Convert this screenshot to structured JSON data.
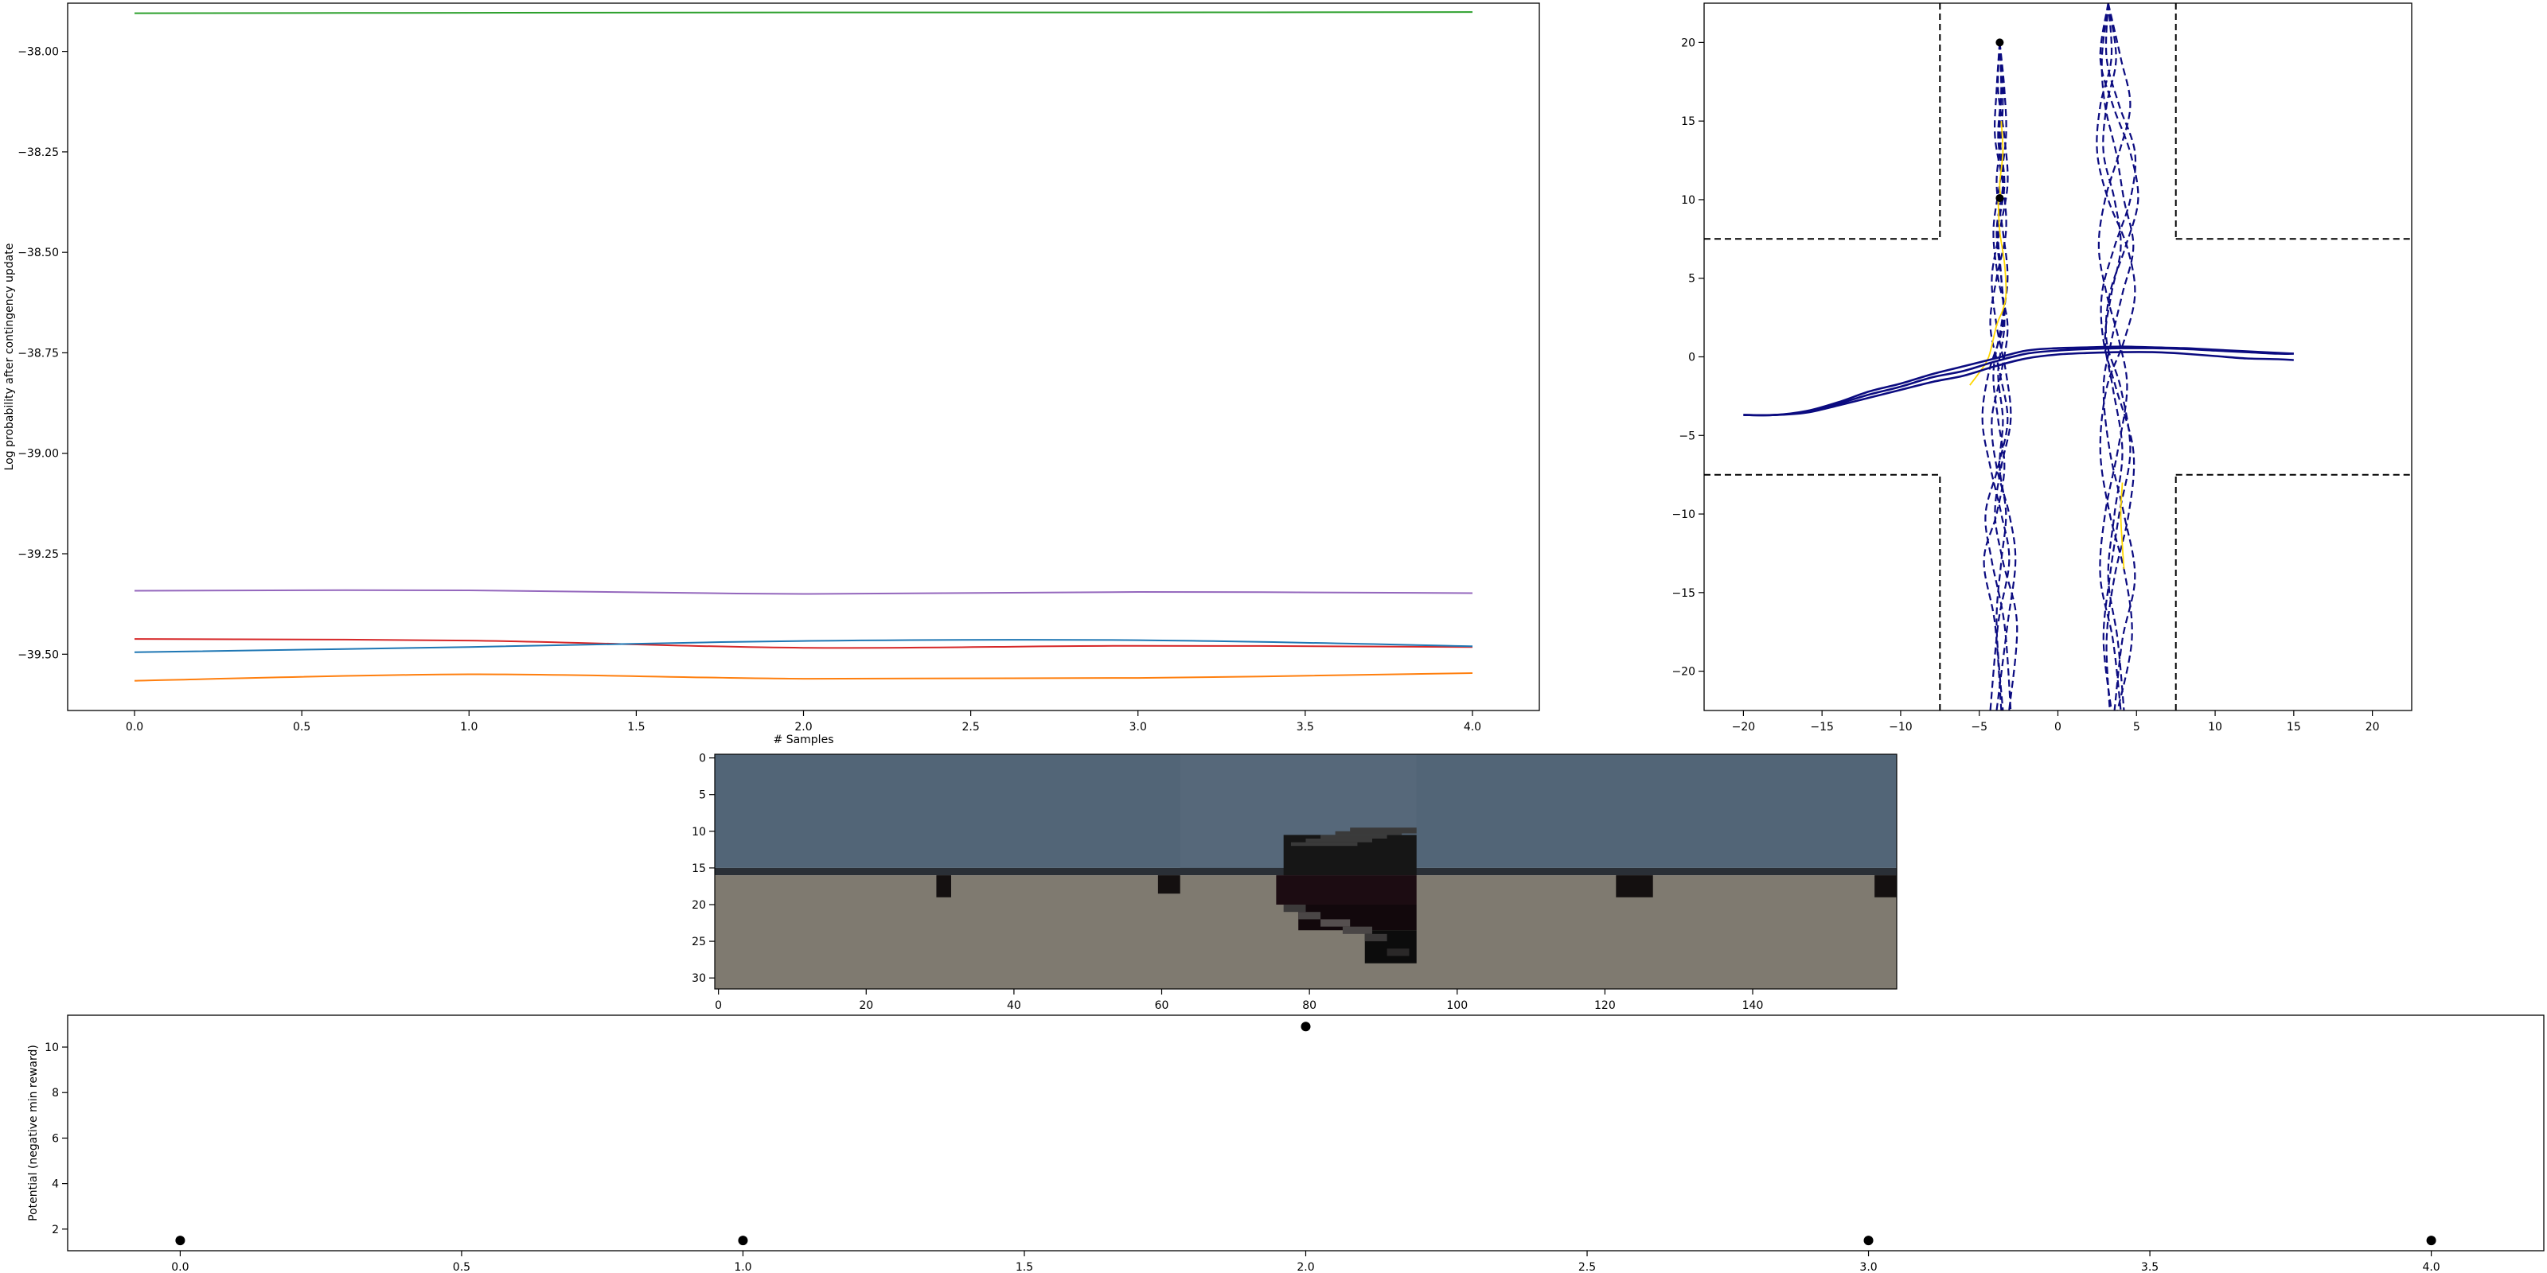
{
  "figure": {
    "panels": 4,
    "colors": {
      "blue": "#1f77b4",
      "orange": "#ff7f0e",
      "green": "#2ca02c",
      "red": "#d62728",
      "purple": "#9467bd",
      "traj_dark": "#0b0b80",
      "traj_yellow": "#ffd700",
      "sky": "#526577",
      "ground": "#7f7a70",
      "vehicle": "#141414"
    }
  },
  "chart_data": [
    {
      "id": "logprob",
      "type": "line",
      "title": "",
      "xlabel": "# Samples",
      "ylabel": "Log probability after contingency update",
      "xlim": [
        -0.2,
        4.2
      ],
      "ylim": [
        -39.64,
        -37.88
      ],
      "xticks": [
        0.0,
        0.5,
        1.0,
        1.5,
        2.0,
        2.5,
        3.0,
        3.5,
        4.0
      ],
      "xtick_labels": [
        "0.0",
        "0.5",
        "1.0",
        "1.5",
        "2.0",
        "2.5",
        "3.0",
        "3.5",
        "4.0"
      ],
      "yticks": [
        -39.5,
        -39.25,
        -39.0,
        -38.75,
        -38.5,
        -38.25,
        -38.0
      ],
      "ytick_labels": [
        "−39.50",
        "−39.25",
        "−39.00",
        "−38.75",
        "−38.50",
        "−38.25",
        "−38.00"
      ],
      "x": [
        0,
        1,
        2,
        3,
        4
      ],
      "series": [
        {
          "color": "#2ca02c",
          "values": [
            -37.905,
            -37.904,
            -37.903,
            -37.903,
            -37.902
          ]
        },
        {
          "color": "#9467bd",
          "values": [
            -39.342,
            -39.341,
            -39.35,
            -39.345,
            -39.348
          ]
        },
        {
          "color": "#d62728",
          "values": [
            -39.462,
            -39.466,
            -39.484,
            -39.479,
            -39.482
          ]
        },
        {
          "color": "#1f77b4",
          "values": [
            -39.495,
            -39.482,
            -39.467,
            -39.465,
            -39.48
          ]
        },
        {
          "color": "#ff7f0e",
          "values": [
            -39.566,
            -39.55,
            -39.561,
            -39.559,
            -39.547
          ]
        }
      ],
      "grid": false,
      "legend": "none"
    },
    {
      "id": "intersection",
      "type": "line",
      "title": "",
      "xlabel": "",
      "ylabel": "",
      "xlim": [
        -22.5,
        22.5
      ],
      "ylim": [
        -22.5,
        22.5
      ],
      "xticks": [
        -20,
        -15,
        -10,
        -5,
        0,
        5,
        10,
        15,
        20
      ],
      "xtick_labels": [
        "−20",
        "−15",
        "−10",
        "−5",
        "0",
        "5",
        "10",
        "15",
        "20"
      ],
      "yticks": [
        -20,
        -15,
        -10,
        -5,
        0,
        5,
        10,
        15,
        20
      ],
      "ytick_labels": [
        "−20",
        "−15",
        "−10",
        "−5",
        "0",
        "5",
        "10",
        "15",
        "20"
      ],
      "road_boundaries": [
        {
          "x": [
            -7.5,
            -7.5
          ],
          "y": [
            22.5,
            7.5
          ]
        },
        {
          "x": [
            -22.5,
            -7.5
          ],
          "y": [
            7.5,
            7.5
          ]
        },
        {
          "x": [
            7.5,
            7.5
          ],
          "y": [
            22.5,
            7.5
          ]
        },
        {
          "x": [
            7.5,
            22.5
          ],
          "y": [
            7.5,
            7.5
          ]
        },
        {
          "x": [
            -7.5,
            -7.5
          ],
          "y": [
            -22.5,
            -7.5
          ]
        },
        {
          "x": [
            -22.5,
            -7.5
          ],
          "y": [
            -7.5,
            -7.5
          ]
        },
        {
          "x": [
            7.5,
            7.5
          ],
          "y": [
            -22.5,
            -7.5
          ]
        },
        {
          "x": [
            7.5,
            22.5
          ],
          "y": [
            -7.5,
            -7.5
          ]
        }
      ],
      "ego_trajectories": [
        {
          "x": [
            -20,
            -18,
            -16,
            -14,
            -12,
            -10,
            -8,
            -6,
            -4,
            -2,
            0,
            2,
            4,
            6,
            8,
            10,
            12,
            14,
            15
          ],
          "y": [
            -3.7,
            -3.7,
            -3.5,
            -3.0,
            -2.4,
            -1.9,
            -1.3,
            -0.9,
            -0.3,
            0.2,
            0.4,
            0.5,
            0.55,
            0.55,
            0.5,
            0.4,
            0.3,
            0.2,
            0.2
          ]
        },
        {
          "x": [
            -20,
            -18,
            -16,
            -14,
            -12,
            -10,
            -8,
            -6,
            -4,
            -2,
            0,
            2,
            4,
            6,
            8,
            10,
            12,
            14,
            15
          ],
          "y": [
            -3.7,
            -3.7,
            -3.45,
            -2.9,
            -2.2,
            -1.7,
            -1.1,
            -0.6,
            -0.1,
            0.4,
            0.55,
            0.6,
            0.65,
            0.6,
            0.55,
            0.45,
            0.35,
            0.25,
            0.2
          ]
        },
        {
          "x": [
            -20,
            -18,
            -16,
            -14,
            -12,
            -10,
            -8,
            -6,
            -4,
            -2,
            0,
            2,
            4,
            6,
            8,
            10,
            12,
            14,
            15
          ],
          "y": [
            -3.7,
            -3.7,
            -3.55,
            -3.1,
            -2.6,
            -2.1,
            -1.6,
            -1.2,
            -0.6,
            -0.1,
            0.15,
            0.25,
            0.3,
            0.3,
            0.2,
            0.05,
            -0.1,
            -0.15,
            -0.2
          ]
        }
      ],
      "agent_trajectories_left": [
        {
          "x": [
            -3.7,
            -3.6,
            -3.8,
            -3.5,
            -3.9,
            -3.6,
            -3.4,
            -3.8,
            -3.5,
            -3.7,
            -3.3,
            -3.6,
            -3.9,
            -3.5
          ],
          "y": [
            20,
            17,
            14,
            11,
            8,
            5,
            2,
            -1,
            -4,
            -7,
            -10,
            -13,
            -17,
            -22.5
          ]
        },
        {
          "x": [
            -3.7,
            -3.4,
            -3.3,
            -3.7,
            -4.1,
            -3.8,
            -3.2,
            -3.6,
            -4.2,
            -3.9,
            -3.1,
            -2.7,
            -3.2,
            -3.9
          ],
          "y": [
            20,
            17,
            14,
            11,
            8,
            5,
            2,
            -1,
            -4,
            -7,
            -10,
            -13,
            -17,
            -22.5
          ]
        },
        {
          "x": [
            -3.7,
            -3.9,
            -4.0,
            -3.5,
            -3.3,
            -3.9,
            -4.3,
            -3.7,
            -3.2,
            -3.8,
            -4.6,
            -4.2,
            -3.4,
            -3.0
          ],
          "y": [
            20,
            17,
            14,
            11,
            8,
            5,
            2,
            -1,
            -4,
            -7,
            -10,
            -13,
            -17,
            -22.5
          ]
        },
        {
          "x": [
            -3.7,
            -3.5,
            -3.6,
            -3.9,
            -3.5,
            -3.2,
            -3.6,
            -4.1,
            -3.8,
            -3.4,
            -3.9,
            -4.7,
            -4.0,
            -3.6
          ],
          "y": [
            20,
            17,
            14,
            11,
            8,
            5,
            2,
            -1,
            -4,
            -7,
            -10,
            -13,
            -17,
            -22.5
          ]
        },
        {
          "x": [
            -3.7,
            -3.8,
            -3.4,
            -3.2,
            -3.7,
            -4.2,
            -3.9,
            -3.3,
            -3.0,
            -3.6,
            -4.0,
            -3.5,
            -2.6,
            -3.1
          ],
          "y": [
            20,
            17,
            14,
            11,
            8,
            5,
            2,
            -1,
            -4,
            -7,
            -10,
            -13,
            -17,
            -22.5
          ]
        },
        {
          "x": [
            -3.7,
            -3.6,
            -3.7,
            -3.4,
            -3.8,
            -3.6,
            -3.5,
            -4.4,
            -4.8,
            -4.3,
            -3.6,
            -3.1,
            -3.8,
            -4.3
          ],
          "y": [
            20,
            17,
            14,
            11,
            8,
            5,
            2,
            -1,
            -4,
            -7,
            -10,
            -13,
            -17,
            -22.5
          ]
        }
      ],
      "agent_trajectories_right": [
        {
          "x": [
            3.2,
            3.7,
            3.1,
            2.9,
            3.6,
            4.0,
            3.4,
            3.0,
            3.5,
            4.1,
            3.6,
            3.2,
            3.8,
            4.2
          ],
          "y": [
            22.5,
            19,
            16,
            13,
            10,
            7,
            4,
            1,
            -2,
            -6,
            -10,
            -14,
            -18,
            -22.5
          ]
        },
        {
          "x": [
            3.2,
            2.7,
            3.5,
            4.6,
            5.1,
            4.3,
            3.3,
            3.1,
            4.0,
            4.6,
            3.9,
            3.3,
            2.9,
            3.4
          ],
          "y": [
            22.5,
            19,
            16,
            13,
            10,
            7,
            4,
            1,
            -2,
            -6,
            -10,
            -14,
            -18,
            -22.5
          ]
        },
        {
          "x": [
            3.2,
            3.4,
            2.7,
            2.5,
            3.2,
            4.4,
            4.9,
            4.2,
            3.1,
            2.7,
            3.3,
            4.3,
            4.7,
            3.8
          ],
          "y": [
            22.5,
            19,
            16,
            13,
            10,
            7,
            4,
            1,
            -2,
            -6,
            -10,
            -14,
            -18,
            -22.5
          ]
        },
        {
          "x": [
            3.2,
            4.0,
            4.6,
            3.9,
            3.0,
            2.6,
            3.1,
            3.9,
            4.4,
            3.8,
            3.0,
            2.7,
            3.5,
            4.0
          ],
          "y": [
            22.5,
            19,
            16,
            13,
            10,
            7,
            4,
            1,
            -2,
            -6,
            -10,
            -14,
            -18,
            -22.5
          ]
        },
        {
          "x": [
            3.2,
            3.1,
            3.9,
            4.9,
            4.6,
            3.6,
            2.8,
            2.9,
            3.7,
            4.8,
            4.5,
            3.6,
            3.1,
            3.3
          ],
          "y": [
            22.5,
            19,
            16,
            13,
            10,
            7,
            4,
            1,
            -2,
            -6,
            -10,
            -14,
            -18,
            -22.5
          ]
        },
        {
          "x": [
            3.2,
            2.8,
            3.0,
            3.7,
            4.2,
            4.8,
            4.1,
            3.4,
            2.9,
            3.3,
            4.2,
            4.9,
            4.1,
            3.6
          ],
          "y": [
            22.5,
            19,
            16,
            13,
            10,
            7,
            4,
            1,
            -2,
            -6,
            -10,
            -14,
            -18,
            -22.5
          ]
        }
      ],
      "yellow_trajectories": [
        {
          "x": [
            -3.8,
            -3.7,
            -3.4,
            -3.3,
            -3.5,
            -3.9,
            -4.4,
            -5.0,
            -5.6
          ],
          "y": [
            10,
            8,
            6,
            4,
            3,
            2,
            0,
            -1,
            -1.8
          ]
        },
        {
          "x": [
            -3.6,
            -3.5,
            -3.7,
            -3.6
          ],
          "y": [
            15,
            13,
            11,
            10
          ]
        },
        {
          "x": [
            4.1,
            4.0,
            4.1,
            4.2
          ],
          "y": [
            -8,
            -10,
            -12,
            -13.5
          ]
        }
      ],
      "markers": [
        {
          "x": -3.7,
          "y": 20
        },
        {
          "x": -3.7,
          "y": 10.1
        }
      ],
      "grid": false,
      "legend": "none"
    },
    {
      "id": "camera",
      "type": "heatmap",
      "title": "",
      "xlabel": "",
      "ylabel": "",
      "width": 160,
      "height": 32,
      "xticks": [
        0,
        20,
        40,
        60,
        80,
        100,
        120,
        140
      ],
      "xtick_labels": [
        "0",
        "20",
        "40",
        "60",
        "80",
        "100",
        "120",
        "140"
      ],
      "yticks": [
        0,
        5,
        10,
        15,
        20,
        25,
        30
      ],
      "ytick_labels": [
        "0",
        "5",
        "10",
        "15",
        "20",
        "25",
        "30"
      ],
      "regions": [
        {
          "name": "sky",
          "x0": 0,
          "x1": 160,
          "y0": 0,
          "y1": 15.5,
          "color": "#526577"
        },
        {
          "name": "sky-shade",
          "x0": 63,
          "x1": 95,
          "y0": 0,
          "y1": 15.5,
          "color": "#56687a"
        },
        {
          "name": "horizon",
          "x0": 0,
          "x1": 160,
          "y0": 15.5,
          "y1": 16.5,
          "color": "#2a2f36"
        },
        {
          "name": "ground",
          "x0": 0,
          "x1": 160,
          "y0": 16.5,
          "y1": 32,
          "color": "#7f7a70"
        },
        {
          "name": "post-1",
          "x0": 30,
          "x1": 32,
          "y0": 16.5,
          "y1": 19.5,
          "color": "#141010"
        },
        {
          "name": "post-2",
          "x0": 60,
          "x1": 63,
          "y0": 16.5,
          "y1": 19,
          "color": "#141010"
        },
        {
          "name": "post-3",
          "x0": 122,
          "x1": 127,
          "y0": 16.5,
          "y1": 19.5,
          "color": "#141010"
        },
        {
          "name": "post-4",
          "x0": 157,
          "x1": 160,
          "y0": 16.5,
          "y1": 19.5,
          "color": "#141010"
        },
        {
          "name": "vehicle-top",
          "x0": 77,
          "x1": 95,
          "y0": 11,
          "y1": 16.5,
          "color": "#161616"
        },
        {
          "name": "vehicle-body",
          "x0": 76,
          "x1": 95,
          "y0": 16.5,
          "y1": 20.5,
          "color": "#1c0c12"
        },
        {
          "name": "vehicle-lower",
          "x0": 79,
          "x1": 95,
          "y0": 20.5,
          "y1": 24,
          "color": "#12080c"
        },
        {
          "name": "vehicle-tail",
          "x0": 88,
          "x1": 95,
          "y0": 24,
          "y1": 28.5,
          "color": "#0c0c0c"
        }
      ]
    },
    {
      "id": "potential",
      "type": "scatter",
      "title": "",
      "xlabel": "",
      "ylabel": "Potential (negative min reward)",
      "xlim": [
        -0.2,
        4.2
      ],
      "ylim": [
        1.05,
        11.4
      ],
      "xticks": [
        0.0,
        0.5,
        1.0,
        1.5,
        2.0,
        2.5,
        3.0,
        3.5,
        4.0
      ],
      "xtick_labels": [
        "0.0",
        "0.5",
        "1.0",
        "1.5",
        "2.0",
        "2.5",
        "3.0",
        "3.5",
        "4.0"
      ],
      "yticks": [
        2,
        4,
        6,
        8,
        10
      ],
      "ytick_labels": [
        "2",
        "4",
        "6",
        "8",
        "10"
      ],
      "x": [
        0,
        1,
        2,
        3,
        4
      ],
      "values": [
        1.5,
        1.5,
        10.9,
        1.5,
        1.5
      ],
      "color": "#000000",
      "grid": false,
      "legend": "none"
    }
  ]
}
